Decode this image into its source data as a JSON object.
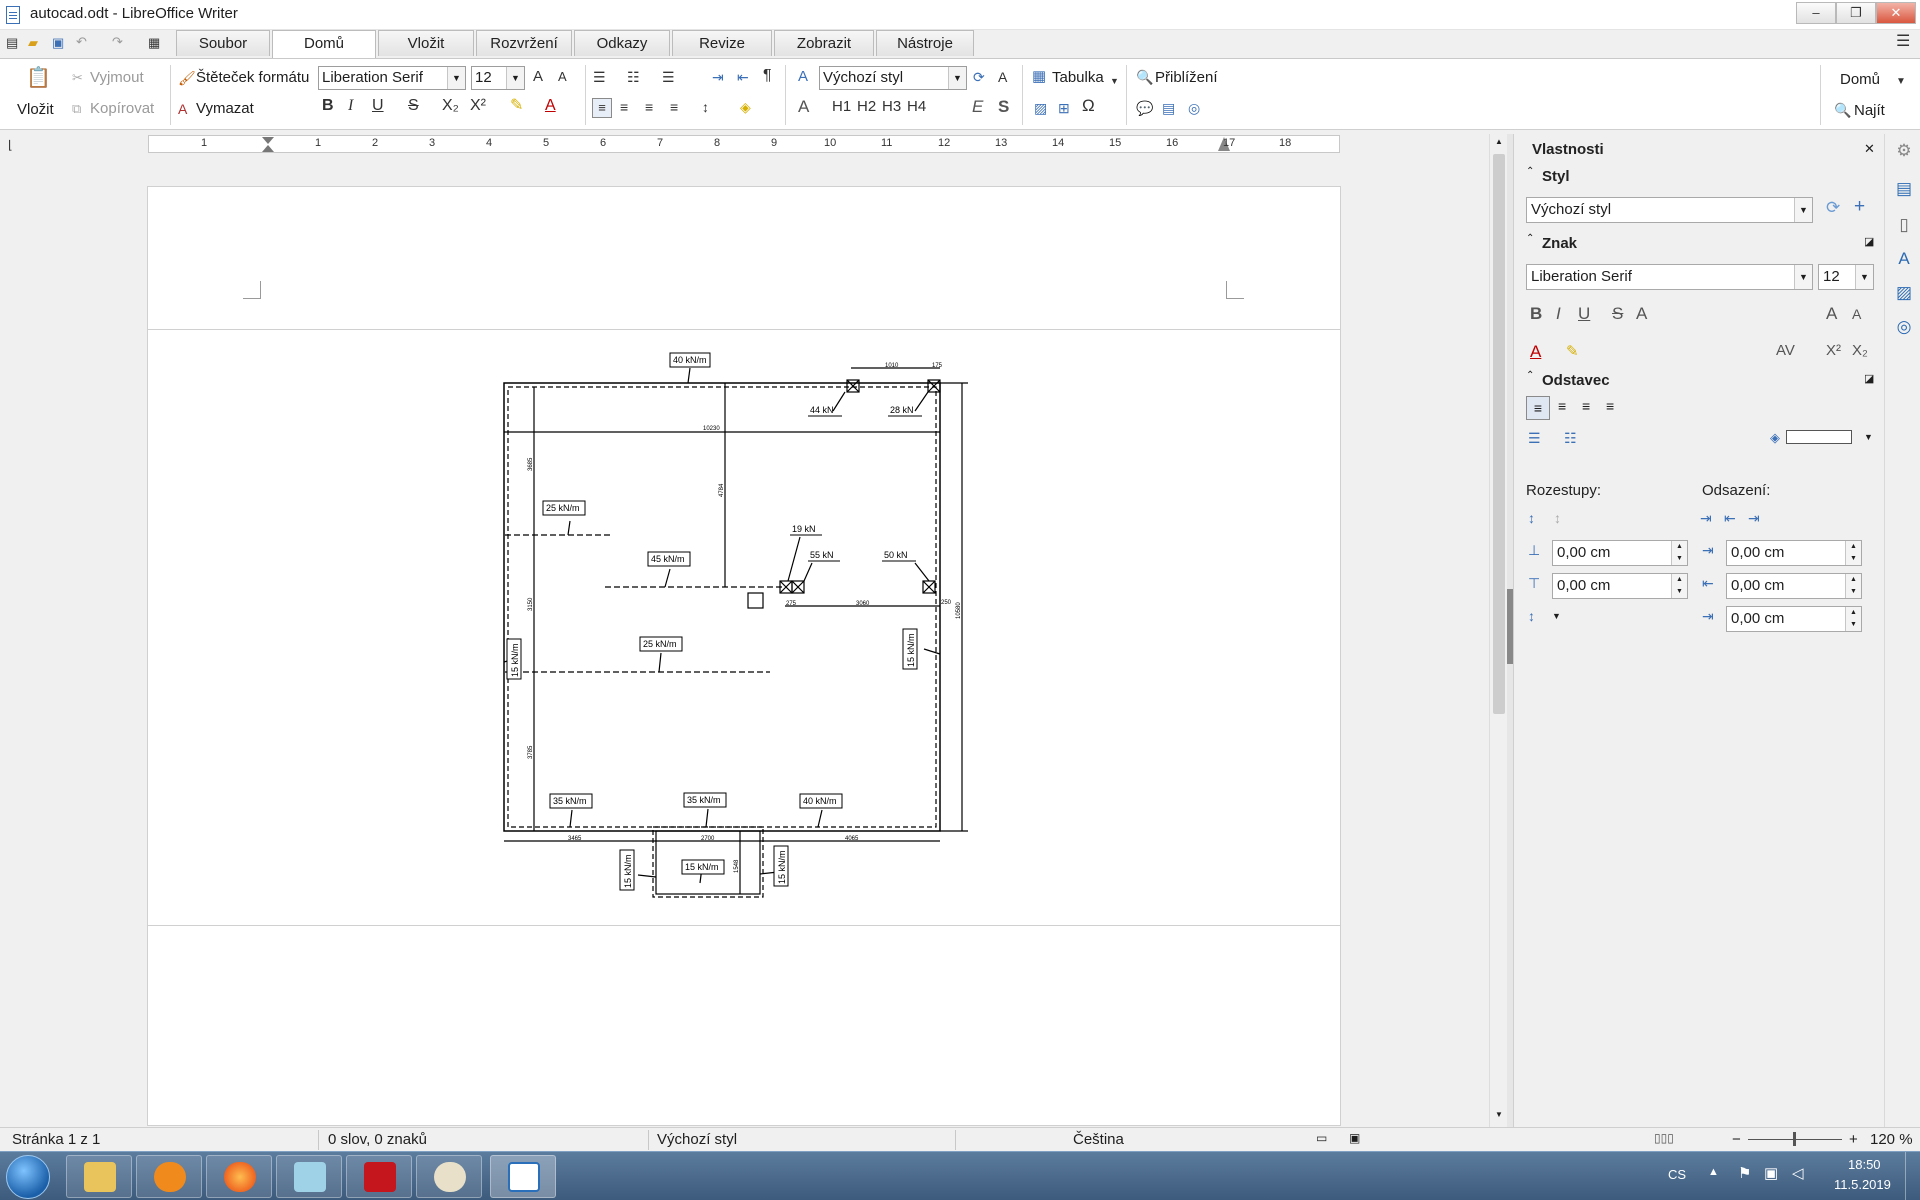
{
  "window": {
    "title": "autocad.odt - LibreOffice Writer",
    "minimize": "–",
    "restore": "❐",
    "close": "✕"
  },
  "tabs": [
    {
      "label": "Soubor"
    },
    {
      "label": "Domů"
    },
    {
      "label": "Vložit"
    },
    {
      "label": "Rozvržení"
    },
    {
      "label": "Odkazy"
    },
    {
      "label": "Revize"
    },
    {
      "label": "Zobrazit"
    },
    {
      "label": "Nástroje"
    }
  ],
  "ribbon": {
    "paste": "Vložit",
    "cut": "Vyjmout",
    "copy": "Kopírovat",
    "clone": "Štěteček formátu",
    "clear": "Vymazat",
    "font_name": "Liberation Serif",
    "font_size": "12",
    "para_style": "Výchozí styl",
    "table": "Tabulka",
    "zoom": "Přiblížení",
    "right_menu": "Domů",
    "find": "Najít",
    "headings": [
      "H1",
      "H2",
      "H3",
      "H4"
    ]
  },
  "ruler": {
    "numbers": [
      "1",
      "1",
      "2",
      "3",
      "4",
      "5",
      "6",
      "7",
      "8",
      "9",
      "10",
      "11",
      "12",
      "13",
      "14",
      "15",
      "16",
      "17",
      "18"
    ]
  },
  "drawing": {
    "loads": {
      "top": "40 kN/m",
      "p44": "44 kN",
      "p28": "28 kN",
      "l25a": "25 kN/m",
      "l45": "45 kN/m",
      "p19": "19 kN",
      "p55": "55 kN",
      "p50": "50 kN",
      "l25b": "25 kN/m",
      "l15left": "15 kN/m",
      "l15right": "15 kN/m",
      "b35a": "35 kN/m",
      "b35b": "35 kN/m",
      "b40": "40 kN/m",
      "l15bl": "15 kN/m",
      "l15bc": "15 kN/m",
      "l15br": "15 kN/m"
    },
    "dims": {
      "d1010": "1010",
      "d175": "175",
      "d10230": "10230",
      "d3685": "3685",
      "d4784": "4784",
      "d3150": "3150",
      "d275": "275",
      "d3060": "3060",
      "d250": "250",
      "d10580": "10580",
      "d3785": "3785",
      "d3465": "3465",
      "d2700": "2700",
      "d4065": "4065",
      "d1548": "1548"
    }
  },
  "sidebar": {
    "title": "Vlastnosti",
    "close": "✕",
    "style_section": "Styl",
    "style_value": "Výchozí styl",
    "char_section": "Znak",
    "font": "Liberation Serif",
    "size": "12",
    "para_section": "Odstavec",
    "spacing_label": "Rozestupy:",
    "indent_label": "Odsazení:",
    "spacing_above": "0,00 cm",
    "spacing_below": "0,00 cm",
    "indent_before": "0,00 cm",
    "indent_after": "0,00 cm",
    "indent_first": "0,00 cm"
  },
  "status": {
    "page": "Stránka 1 z 1",
    "words": "0 slov, 0 znaků",
    "style": "Výchozí styl",
    "language": "Čeština",
    "zoom": "120 %"
  },
  "taskbar": {
    "lang": "CS",
    "time": "18:50",
    "date": "11.5.2019"
  }
}
